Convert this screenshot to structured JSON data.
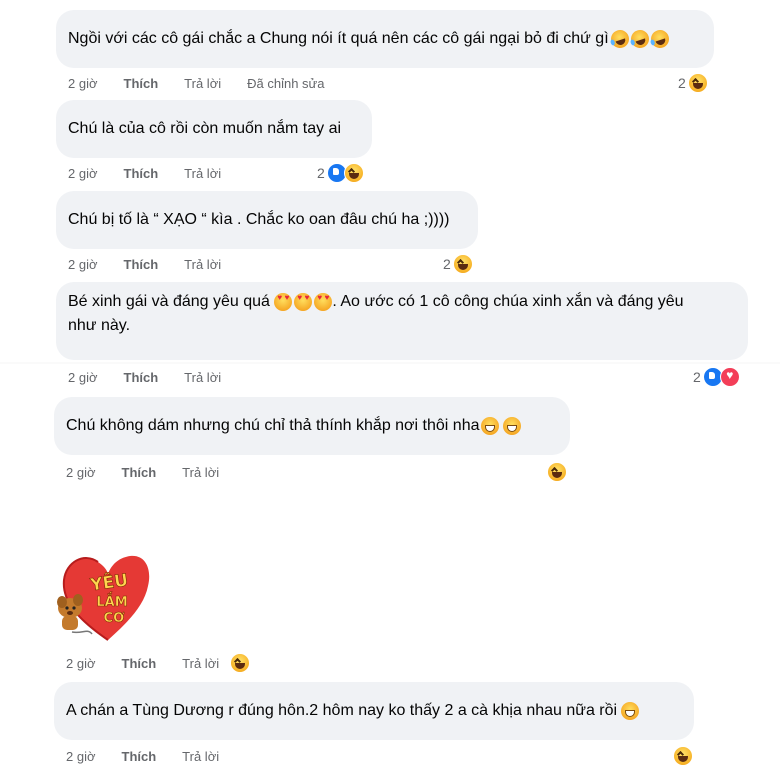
{
  "comments": [
    {
      "text": "Ngồi với các cô gái chắc a Chung nói ít quá nên các cô gái ngại bỏ đi chứ gì",
      "time": "2 giờ",
      "like": "Thích",
      "reply": "Trả lời",
      "edited": "Đã chỉnh sửa",
      "reaction_count": "2"
    },
    {
      "text": "Chú là của cô rồi còn muốn nắm tay ai",
      "time": "2 giờ",
      "like": "Thích",
      "reply": "Trả lời",
      "reaction_count": "2"
    },
    {
      "text": "Chú bị tố là “ XẠO “ kìa . Chắc ko oan đâu chú ha ;))))",
      "time": "2 giờ",
      "like": "Thích",
      "reply": "Trả lời",
      "reaction_count": "2"
    },
    {
      "text_line1": "Bé xinh gái và đáng yêu quá ",
      "text_line1b": ". Ao ước có 1 cô công chúa xinh xắn và đáng yêu",
      "text_line2": "như này.",
      "time": "2 giờ",
      "like": "Thích",
      "reply": "Trả lời",
      "reaction_count": "2"
    },
    {
      "text": "Chú không dám nhưng chú chỉ thả thính khắp nơi thôi nha",
      "time": "2 giờ",
      "like": "Thích",
      "reply": "Trả lời"
    },
    {
      "sticker_text": "YÊU LẮM CƠ",
      "time": "2 giờ",
      "like": "Thích",
      "reply": "Trả lời"
    },
    {
      "text": "A chán a Tùng Dương r đúng hôn.2 hôm nay ko thấy 2 a cà khịa nhau nữa rồi",
      "time": "2 giờ",
      "like": "Thích",
      "reply": "Trả lời"
    }
  ],
  "icons": {
    "haha": "haha-reaction-icon",
    "like": "like-reaction-icon",
    "love": "love-reaction-icon",
    "emoji_heart_eyes": "heart-eyes-emoji",
    "emoji_grin": "grinning-emoji",
    "emoji_rofl": "rolling-laughing-emoji"
  },
  "colors": {
    "bubble": "#f0f2f5",
    "meta": "#65676b",
    "like_blue": "#1877f2",
    "love_red": "#f33e58",
    "haha_yellow": "#f7b125"
  }
}
